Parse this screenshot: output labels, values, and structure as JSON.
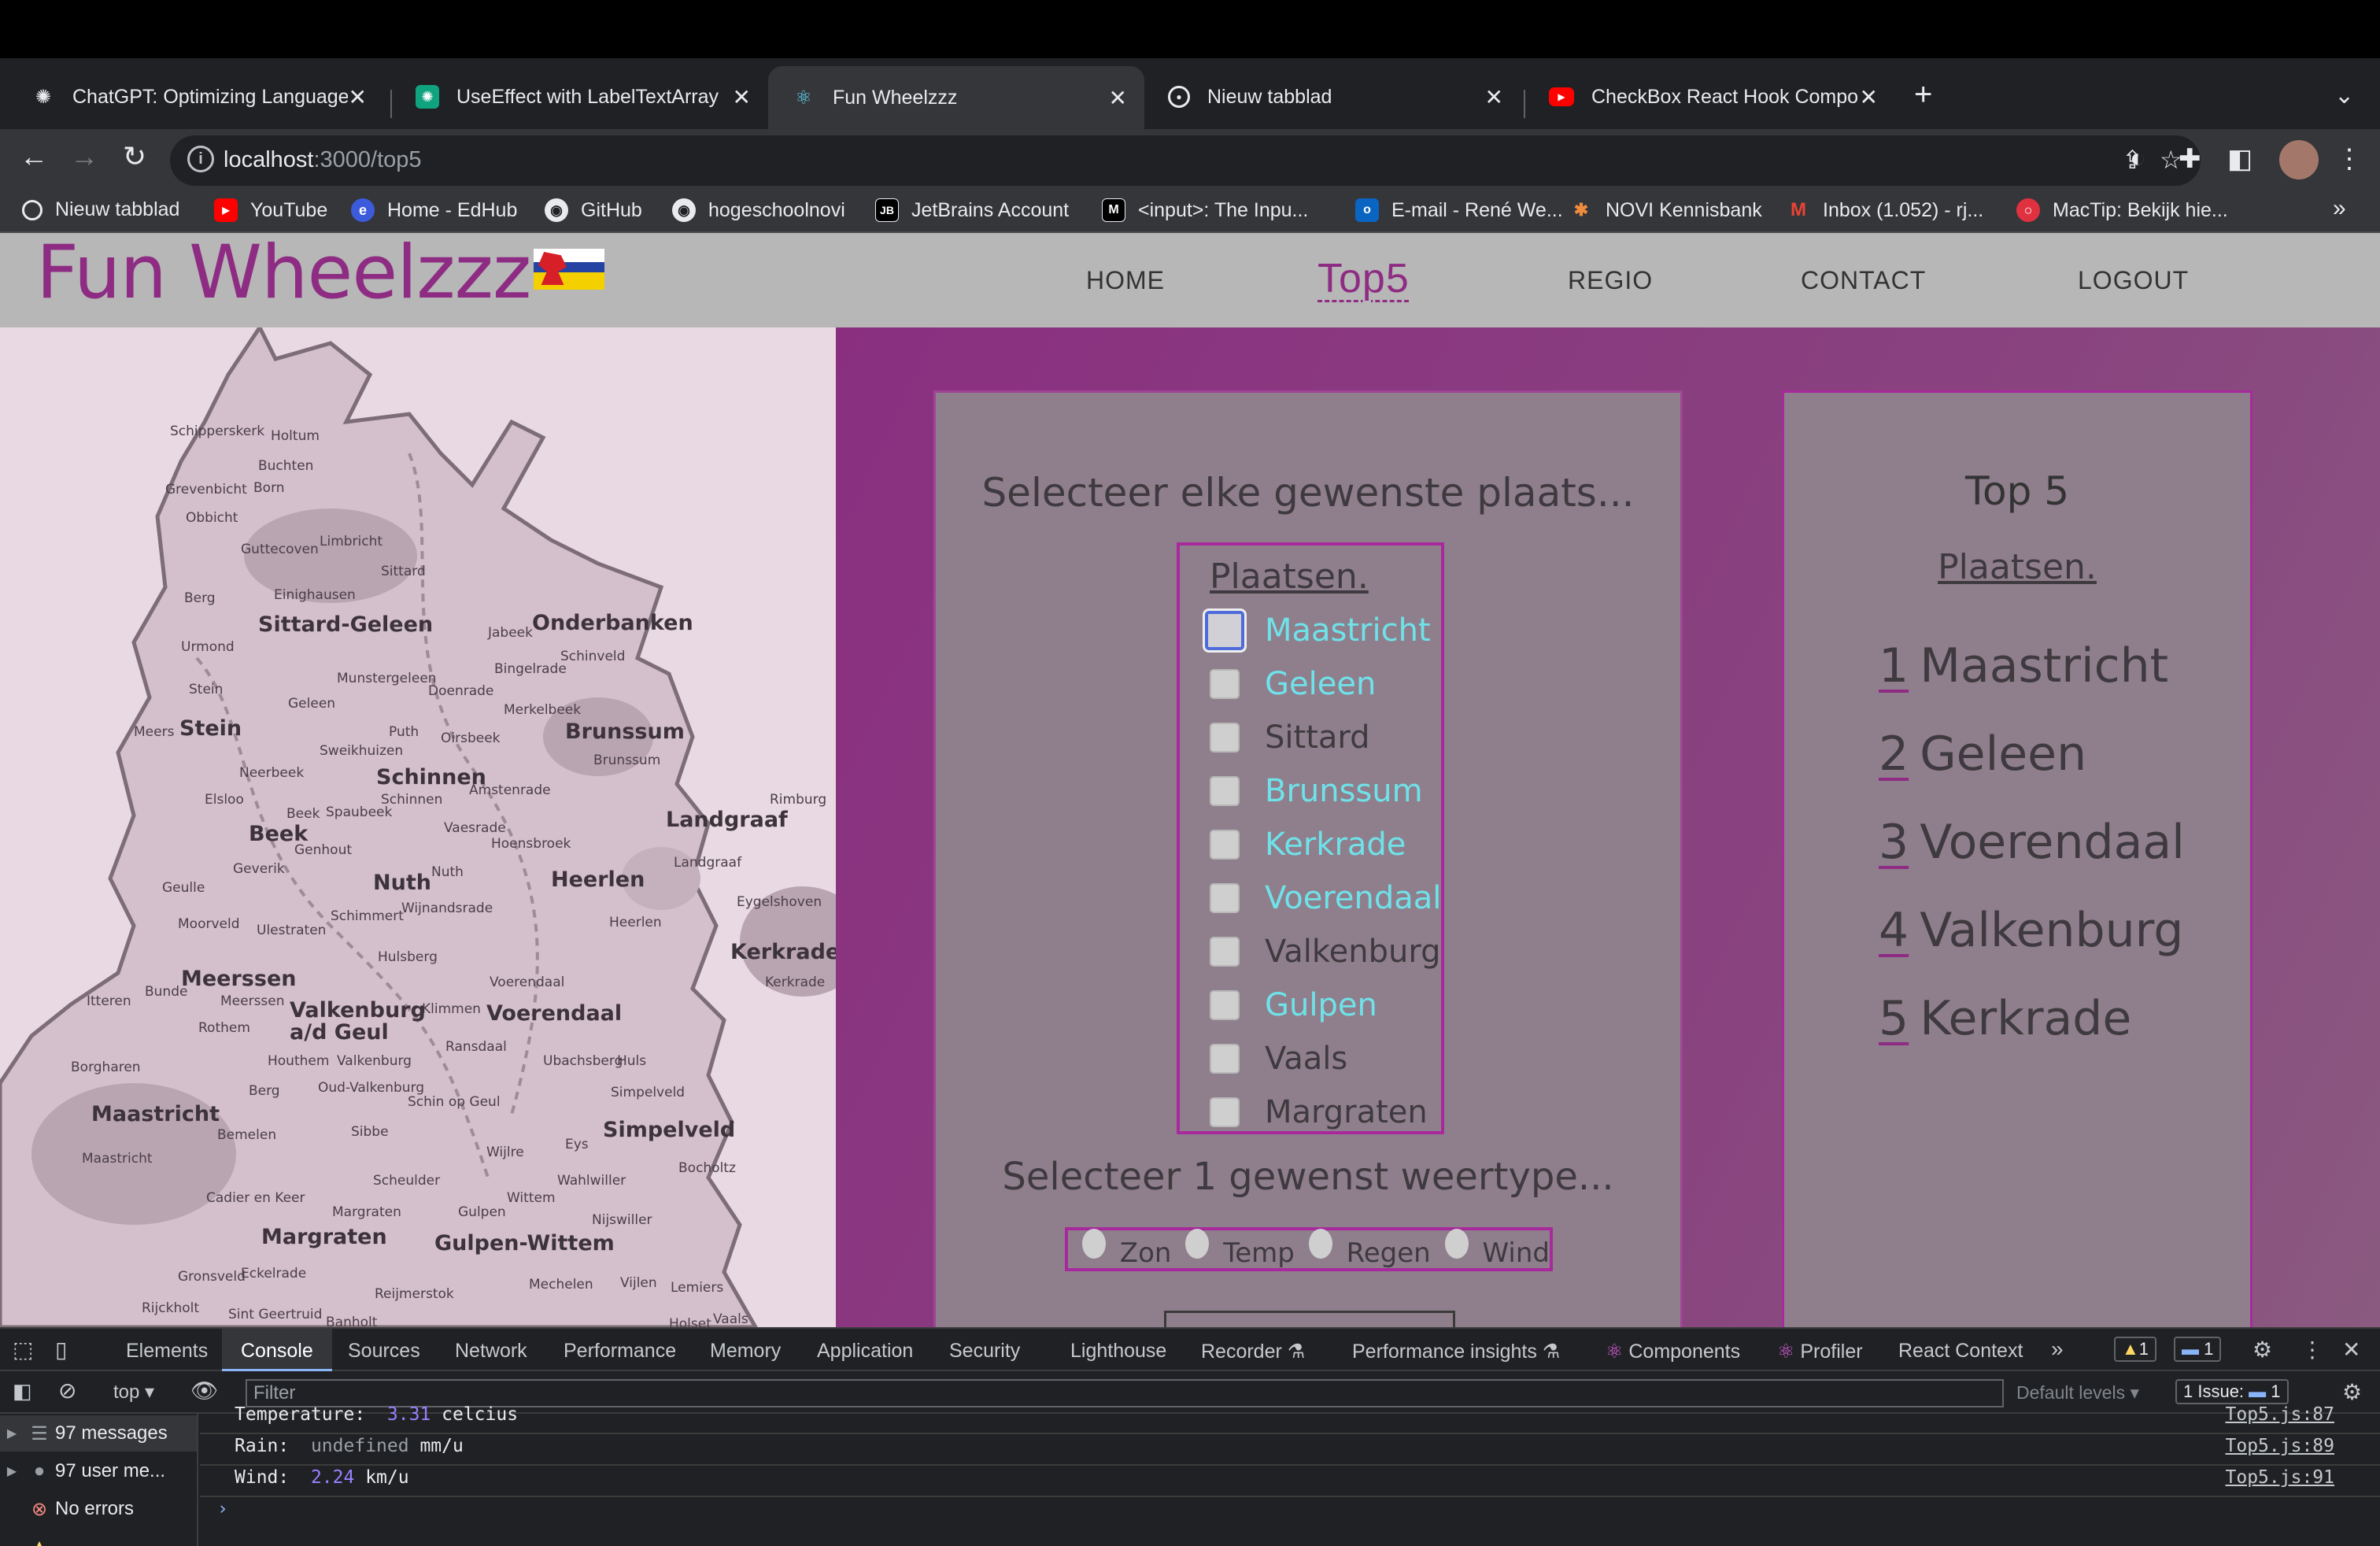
{
  "browser": {
    "tabs": [
      {
        "title": "ChatGPT: Optimizing Language",
        "icon": "openai-icon"
      },
      {
        "title": "UseEffect with LabelTextArray",
        "icon": "openai-icon"
      },
      {
        "title": "Fun Wheelzzz",
        "icon": "react-icon",
        "active": true
      },
      {
        "title": "Nieuw tabblad",
        "icon": "chrome-icon"
      },
      {
        "title": "CheckBox React Hook Compone",
        "icon": "youtube-icon"
      }
    ],
    "url_host": "localhost",
    "url_path": ":3000/top5",
    "bookmarks": [
      "Nieuw tabblad",
      "YouTube",
      "Home - EdHub",
      "GitHub",
      "hogeschoolnovi",
      "JetBrains Account",
      "<input>: The Inpu...",
      "E-mail - René We...",
      "NOVI Kennisbank",
      "Inbox (1.052) - rj...",
      "MacTip: Bekijk hie..."
    ],
    "bookmark_more": "»"
  },
  "site": {
    "logo": "Fun Wheelzzz",
    "nav": [
      "HOME",
      "Top5",
      "REGIO",
      "CONTACT",
      "LOGOUT"
    ],
    "active_nav": "Top5"
  },
  "map": {
    "labels": [
      "Schipperskerk",
      "Holtum",
      "Buchten",
      "Grevenbicht",
      "Born",
      "Obbicht",
      "Limbricht",
      "Guttecoven",
      "Sittard",
      "Berg",
      "Einighausen",
      "Sittard-Geleen",
      "Urmond",
      "Jabeek",
      "Onderbanken",
      "Schinveld",
      "Bingelrade",
      "Munstergeleen",
      "Doenrade",
      "Stein",
      "Geleen",
      "Merkelbeek",
      "Meers",
      "Stein",
      "Puth",
      "Oirsbeek",
      "Brunssum",
      "Sweikhuizen",
      "Brunssum",
      "Neerbeek",
      "Schinnen",
      "Amstenrade",
      "Elsloo",
      "Beek",
      "Spaubeek",
      "Schinnen",
      "Rimburg",
      "Beek",
      "Genhout",
      "Vaesrade",
      "Hoensbroek",
      "Landgraaf",
      "Geverik",
      "Nuth",
      "Nuth",
      "Heerlen",
      "Landgraaf",
      "Geulle",
      "Schimmert",
      "Wijnandsrade",
      "Eygelshoven",
      "Moorveld",
      "Ulestraten",
      "Heerlen",
      "Kerkrade",
      "Hulsberg",
      "Meerssen",
      "Voerendaal",
      "Kerkrade",
      "Bunde",
      "Meerssen",
      "Klimmen",
      "Voerendaal",
      "Itteren",
      "Valkenburg a/d Geul",
      "Rothem",
      "Ransdaal",
      "Houthem",
      "Valkenburg",
      "Ubachsberg",
      "Huls",
      "Borgharen",
      "Berg",
      "Oud-Valkenburg",
      "Schin op Geul",
      "Simpelveld",
      "Maastricht",
      "Bemelen",
      "Sibbe",
      "Simpelveld",
      "Maastricht",
      "Wijlre",
      "Eys",
      "Bocholtz",
      "Scheulder",
      "Wahlwiller",
      "Cadier en Keer",
      "Margraten",
      "Wittem",
      "Gulpen",
      "Nijswiller",
      "Margraten",
      "Gulpen-Wittem",
      "Gronsveld",
      "Eckelrade",
      "Mechelen",
      "Vijlen",
      "Lemiers",
      "Rijckholt",
      "Reijmerstok",
      "Sint Geertruid",
      "Banholt",
      "Holset",
      "Vaals"
    ]
  },
  "selection": {
    "heading": "Selecteer elke gewenste plaats...",
    "places_title": "Plaatsen.",
    "places": [
      {
        "name": "Maastricht",
        "checked": true,
        "focused": true
      },
      {
        "name": "Geleen",
        "checked": true
      },
      {
        "name": "Sittard",
        "checked": false
      },
      {
        "name": "Brunssum",
        "checked": true
      },
      {
        "name": "Kerkrade",
        "checked": true
      },
      {
        "name": "Voerendaal",
        "checked": true
      },
      {
        "name": "Valkenburg",
        "checked": false
      },
      {
        "name": "Gulpen",
        "checked": true
      },
      {
        "name": "Vaals",
        "checked": false
      },
      {
        "name": "Margraten",
        "checked": false
      }
    ],
    "weather_heading": "Selecteer 1 gewenst weertype...",
    "weather_options": [
      "Zon",
      "Temp",
      "Regen",
      "Wind"
    ]
  },
  "top5": {
    "heading": "Top 5",
    "subheading": "Plaatsen.",
    "items": [
      {
        "rank": "1",
        "name": "Maastricht"
      },
      {
        "rank": "2",
        "name": "Geleen"
      },
      {
        "rank": "3",
        "name": "Voerendaal"
      },
      {
        "rank": "4",
        "name": "Valkenburg"
      },
      {
        "rank": "5",
        "name": "Kerkrade"
      }
    ]
  },
  "devtools": {
    "tabs": [
      "Elements",
      "Console",
      "Sources",
      "Network",
      "Performance",
      "Memory",
      "Application",
      "Security",
      "Lighthouse",
      "Recorder",
      "Performance insights",
      "Components",
      "Profiler",
      "React Context"
    ],
    "active_tab": "Console",
    "context": "top",
    "filter_placeholder": "Filter",
    "default_levels": "Default levels",
    "issues": "1 Issue:",
    "issue_count": "1",
    "warn_count": "1",
    "info_count": "1",
    "sidebar": [
      {
        "label": "97 messages",
        "icon": "list-icon"
      },
      {
        "label": "97 user me...",
        "icon": "user-icon"
      },
      {
        "label": "No errors",
        "icon": "error-icon"
      }
    ],
    "logs": [
      {
        "key": "Temperature:",
        "value": "3.31",
        "unit": "celcius",
        "source": "Top5.js:87"
      },
      {
        "key": "Rain:",
        "value": "undefined",
        "unit": "mm/u",
        "source": "Top5.js:89"
      },
      {
        "key": "Wind:",
        "value": "2.24",
        "unit": "km/u",
        "source": "Top5.js:91"
      }
    ]
  }
}
